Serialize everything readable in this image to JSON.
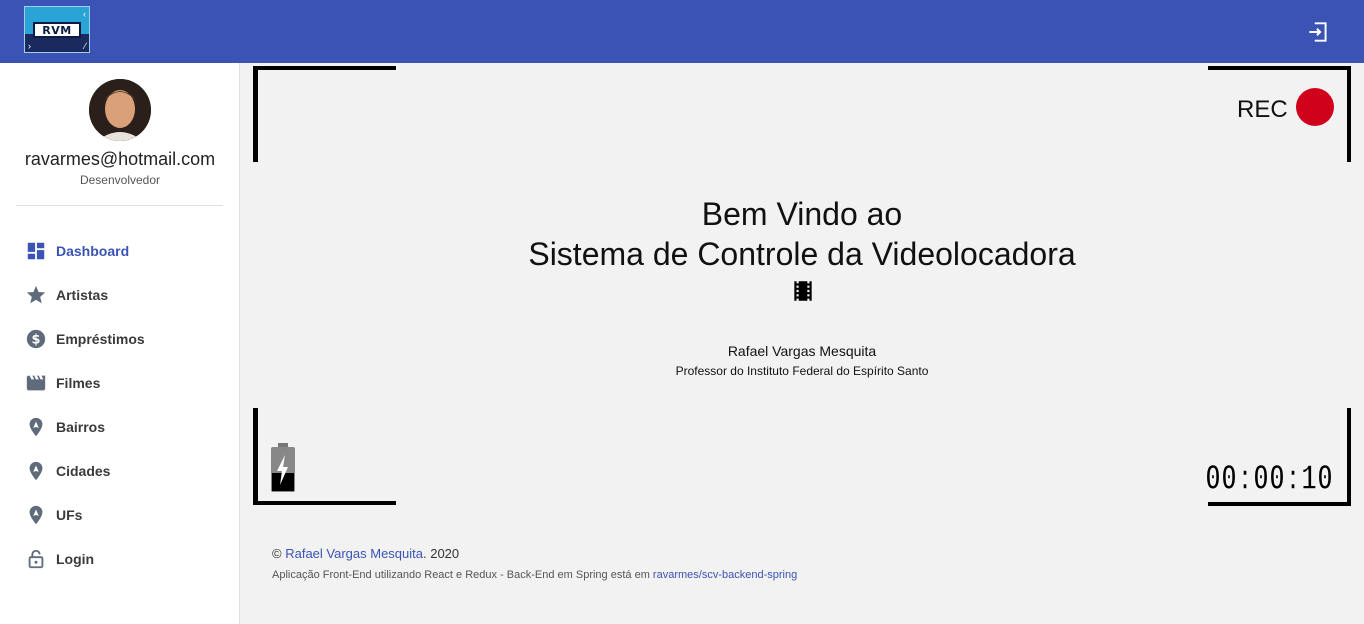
{
  "header": {
    "logo_text": "RVM",
    "logout_icon": "logout-icon",
    "color": "#3a53b5"
  },
  "sidebar": {
    "user": {
      "email": "ravarmes@hotmail.com",
      "role": "Desenvolvedor"
    },
    "items": [
      {
        "label": "Dashboard",
        "icon": "dashboard-icon",
        "active": true
      },
      {
        "label": "Artistas",
        "icon": "star-icon"
      },
      {
        "label": "Empréstimos",
        "icon": "dollar-icon"
      },
      {
        "label": "Filmes",
        "icon": "movie-icon"
      },
      {
        "label": "Bairros",
        "icon": "location-icon"
      },
      {
        "label": "Cidades",
        "icon": "location-icon"
      },
      {
        "label": "UFs",
        "icon": "location-icon"
      },
      {
        "label": "Login",
        "icon": "lock-icon"
      }
    ]
  },
  "main": {
    "rec_label": "REC",
    "rec_color": "#d0021b",
    "welcome_line1": "Bem Vindo ao",
    "welcome_line2": "Sistema de Controle da Videolocadora",
    "author_name": "Rafael Vargas Mesquita",
    "author_title": "Professor do Instituto Federal do Espírito Santo",
    "timer": "00:00:10"
  },
  "footer": {
    "copyright_symbol": "©",
    "author_link": "Rafael Vargas Mesquita",
    "year": ". 2020",
    "description": "Aplicação Front-End utilizando React e Redux - Back-End em Spring está em ",
    "repo_link": "ravarmes/scv-backend-spring"
  }
}
